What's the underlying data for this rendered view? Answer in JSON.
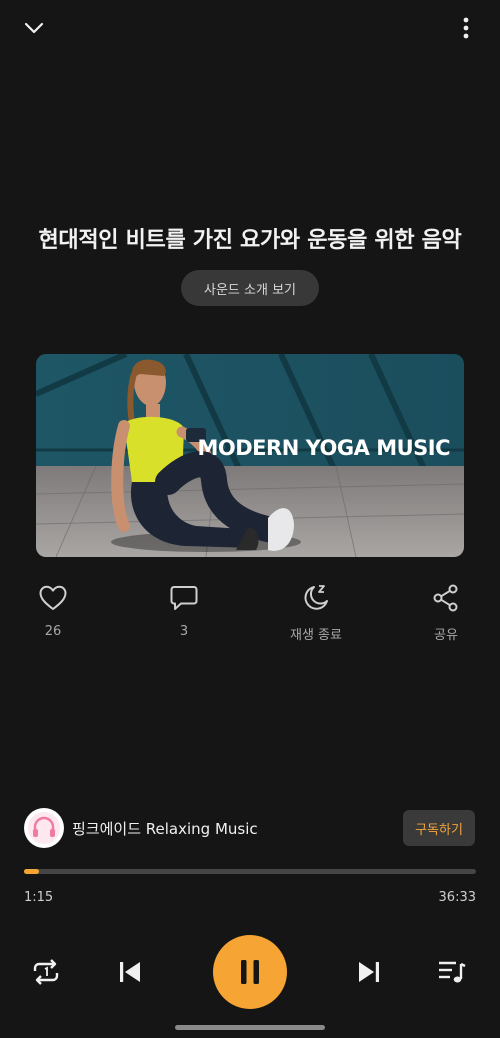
{
  "title": "현대적인 비트를 가진 요가와 운동을 위한 음악",
  "sound_intro_button": "사운드 소개 보기",
  "artwork": {
    "overlay_text": "MODERN YOGA MUSIC"
  },
  "actions": {
    "like": {
      "icon": "heart-icon",
      "label": "26"
    },
    "comment": {
      "icon": "comment-icon",
      "label": "3"
    },
    "sleep_timer": {
      "icon": "moon-icon",
      "label": "재생 종료"
    },
    "share": {
      "icon": "share-icon",
      "label": "공유"
    }
  },
  "channel": {
    "name": "핑크에이드 Relaxing Music",
    "subscribe_label": "구독하기"
  },
  "progress": {
    "current": "1:15",
    "total": "36:33",
    "fraction": 0.034
  },
  "colors": {
    "accent": "#F6A534",
    "background": "#151515"
  }
}
